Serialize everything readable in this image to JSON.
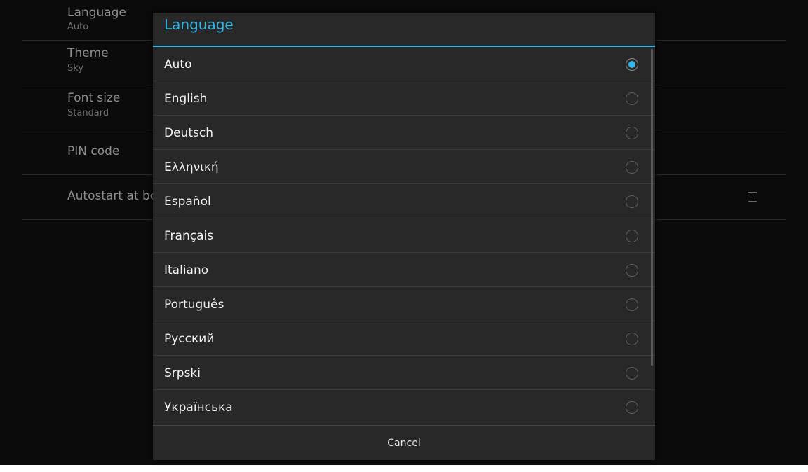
{
  "settings": {
    "items": [
      {
        "title": "Language",
        "summary": "Auto"
      },
      {
        "title": "Theme",
        "summary": "Sky"
      },
      {
        "title": "Font size",
        "summary": "Standard"
      },
      {
        "title": "PIN code"
      },
      {
        "title": "Autostart at boo"
      }
    ]
  },
  "dialog": {
    "title": "Language",
    "options": [
      {
        "label": "Auto",
        "selected": true
      },
      {
        "label": "English"
      },
      {
        "label": "Deutsch"
      },
      {
        "label": "Ελληνική"
      },
      {
        "label": "Español"
      },
      {
        "label": "Français"
      },
      {
        "label": "Italiano"
      },
      {
        "label": "Português"
      },
      {
        "label": "Русский"
      },
      {
        "label": "Srpski"
      },
      {
        "label": "Українська"
      }
    ],
    "cancel_label": "Cancel"
  },
  "colors": {
    "accent": "#33b5e5",
    "dialog_bg": "#282828",
    "screen_bg": "#0b0b0b"
  }
}
